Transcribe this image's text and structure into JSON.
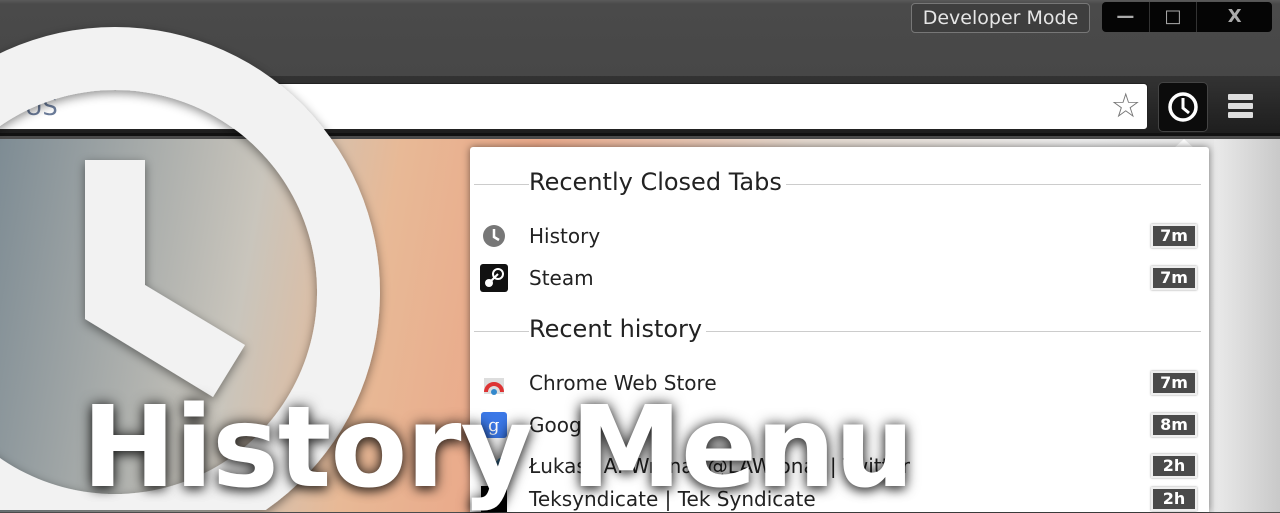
{
  "window": {
    "developer_mode": "Developer Mode",
    "minimize": "—",
    "maximize": "□",
    "close": "X"
  },
  "omnibox": {
    "url": "n-US"
  },
  "toolbar": {
    "icons": [
      "star-icon",
      "history-clock-icon",
      "menu-icon"
    ]
  },
  "popup": {
    "recently_closed_title": "Recently Closed Tabs",
    "recently_closed": [
      {
        "label": "History",
        "time": "7m",
        "icon": "history-icon"
      },
      {
        "label": "Steam",
        "time": "7m",
        "icon": "steam-icon"
      }
    ],
    "recent_history_title": "Recent history",
    "recent_history": [
      {
        "label": "Chrome Web Store",
        "time": "7m",
        "icon": "chrome-web-store-icon"
      },
      {
        "label": "Google",
        "time": "8m",
        "icon": "google-icon"
      },
      {
        "label": "Łukasz A. Wrona (@LAWrona) | Twitter",
        "time": "2h",
        "icon": "twitter-icon"
      },
      {
        "label": "Teksyndicate | Tek Syndicate",
        "time": "2h",
        "icon": "teksyndicate-icon"
      }
    ]
  },
  "overlay": {
    "title": "History Menu"
  },
  "colors": {
    "badge": "#4a4a4a",
    "toolbar": "#2a2a2a",
    "titlebar": "#4a4a4a"
  }
}
